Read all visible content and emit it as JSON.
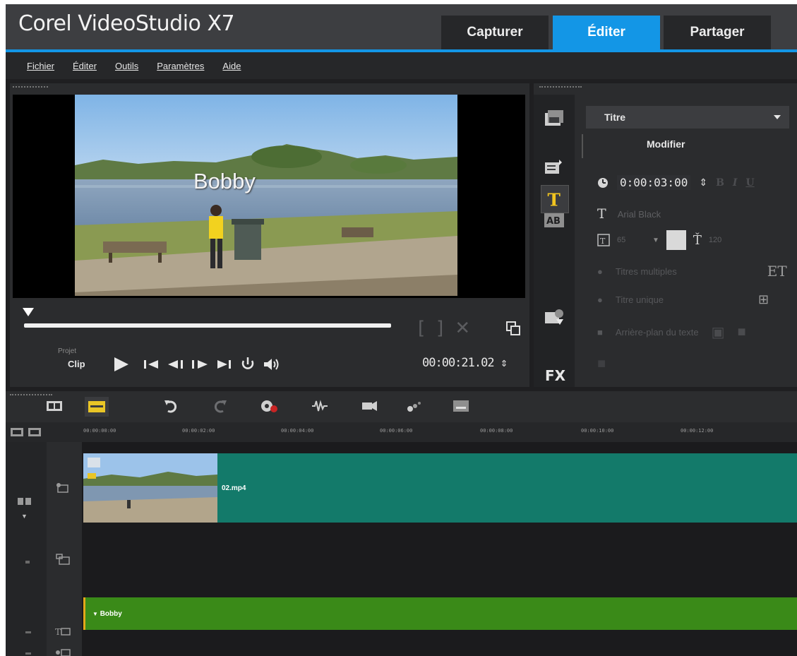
{
  "app": {
    "title": "Corel VideoStudio X7"
  },
  "tabs": [
    {
      "label": "Capturer",
      "active": false
    },
    {
      "label": "Éditer",
      "active": true
    },
    {
      "label": "Partager",
      "active": false
    }
  ],
  "menu": [
    "Fichier",
    "Éditer",
    "Outils",
    "Paramètres",
    "Aide"
  ],
  "player": {
    "overlay_text": "Bobby",
    "mode_projet": "Projet",
    "mode_clip": "Clip",
    "timecode": "00:00:21.02",
    "scrub_position": 0.0
  },
  "library": {
    "dropdown_value": "Titre",
    "section_label": "Modifier",
    "duration": "0:00:03:00",
    "format_buttons": [
      "B",
      "I",
      "U"
    ],
    "font_name": "Arial Black",
    "font_size": "65",
    "line_spacing": "120",
    "text_color": "#d9d9d9",
    "options": [
      "Titres multiples",
      "Titre unique",
      "Arrière-plan du texte"
    ],
    "side_icons": [
      "media-icon",
      "instant-project-icon",
      "transition-icon",
      "title-icon",
      "graphics-icon",
      "filter-icon"
    ],
    "fx_label": "FX"
  },
  "timeline": {
    "ruler_ticks": [
      "00:00:00:00",
      "00:00:02:00",
      "00:00:04:00",
      "00:00:06:00",
      "00:00:08:00",
      "00:00:10:00",
      "00:00:12:00"
    ],
    "video_clip_name": "02.mp4",
    "title_clip_name": "Bobby"
  },
  "colors": {
    "accent": "#1396e6",
    "video_track": "#137a6a",
    "title_track": "#3a8a18",
    "panel": "#2b2c2e"
  }
}
